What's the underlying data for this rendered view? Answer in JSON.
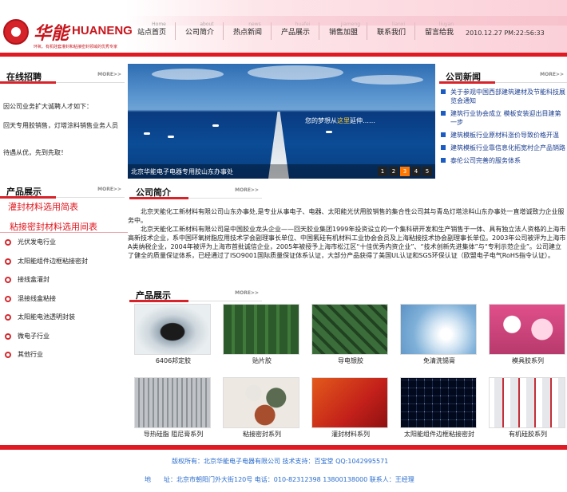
{
  "brand": {
    "name_cn": "华能",
    "name_en": "HUANENG",
    "tagline": "环氧、有机硅套灌封和粘接密封领域的优秀专家"
  },
  "nav": [
    {
      "en": "Home",
      "cn": "站点首页"
    },
    {
      "en": "about",
      "cn": "公司简介"
    },
    {
      "en": "news",
      "cn": "热点新闻"
    },
    {
      "en": "huafei",
      "cn": "产品展示"
    },
    {
      "en": "jiameng",
      "cn": "销售加盟"
    },
    {
      "en": "lianxi",
      "cn": "联系我们"
    },
    {
      "en": "liuyan",
      "cn": "留言给我"
    }
  ],
  "clock": "2010.12.27 PM:22:56:33",
  "more_label": "MORE>>",
  "recruit": {
    "title": "在线招聘",
    "lines": [
      "因公司业务扩大诚聘人才如下：",
      "回天专用胶销售，灯塔涂料销售业务人员",
      "待遇从优，先到先取！"
    ]
  },
  "banner": {
    "slogan_pre": "您的梦想从",
    "slogan_hl": "这里",
    "slogan_post": "延伸……",
    "caption": "北京华能电子电器专用胶山东办事处",
    "pages": [
      "1",
      "2",
      "3",
      "4",
      "5"
    ],
    "active_page": 3
  },
  "news": {
    "title": "公司新闻",
    "items": [
      "关于参观中国西部建筑建材及节能科技展览会通知",
      "建筑行业协会成立 模板安装迎出目建第一步",
      "建筑模板行业原材料涨价导致价格开温",
      "建筑模板行业靠信息化拓宽村企产品销路",
      "泰伦公司完善的服务体系"
    ]
  },
  "products_side": {
    "title": "产品展示",
    "link1": "灌封材料选用简表",
    "link2": "粘接密封材料选用间表",
    "categories": [
      "光伏发电行业",
      "太阳能组件边框粘接密封",
      "接线盒灌封",
      "混接线盒粘接",
      "太阳能电池透明封装",
      "微电子行业",
      "其他行业"
    ]
  },
  "about": {
    "title": "公司简介",
    "para1": "北京天能化工新材料有限公司山东办事处,是专业从事电子、电器、太阳能光伏用胶销售的集合性公司其与青岛灯塔涂料山东办事处一直增诚致力企业服务中。",
    "para2": "北京天能化工新材料有限公司是中国胶业龙头企业——回天胶业集团1999年投资设立的一个集科研开发和生产销售于一体、具有独立法人资格的上海市高新技术企业，系中国环氧树脂应用技术学会副理事长单位、中国氟硅有机材料工业协会会员及上海粘接技术协会副理事长单位。2003年公司被评为上海市A类纳税企业，2004年被评为上海市首批诚信企业，2005年被授予上海市松江区“十佳优秀内资企业”、“技术创新先进集体”与“专利示范企业”。公司建立了健全的质量保证体系，已经通过了ISO9001国际质量保证体系认证，大部分产品获得了美国UL认证和SGS环保认证（欧盟电子电气RoHS指令认证）。"
  },
  "products": {
    "title": "产品展示",
    "items": [
      "6406邦定胶",
      "贴片胶",
      "导电银胶",
      "免清洗锡膏",
      "模具胶系列",
      "导热硅脂 阻尼膏系列",
      "粘接密封系列",
      "灌封材料系列",
      "太阳能组件边框粘接密封",
      "有机硅胶系列"
    ]
  },
  "footer": {
    "line1": "版权所有：北京华能电子电器有限公司 技术支持：百宝堂 QQ:1042995571",
    "line2": "地　　址：北京市朝阳门外大街120号 电话：010-82312398 13800138000 联系人：王经理"
  },
  "colors": {
    "accent_red": "#e01a22",
    "link_blue": "#1a3d8f",
    "footer_blue": "#2a6ccc"
  }
}
